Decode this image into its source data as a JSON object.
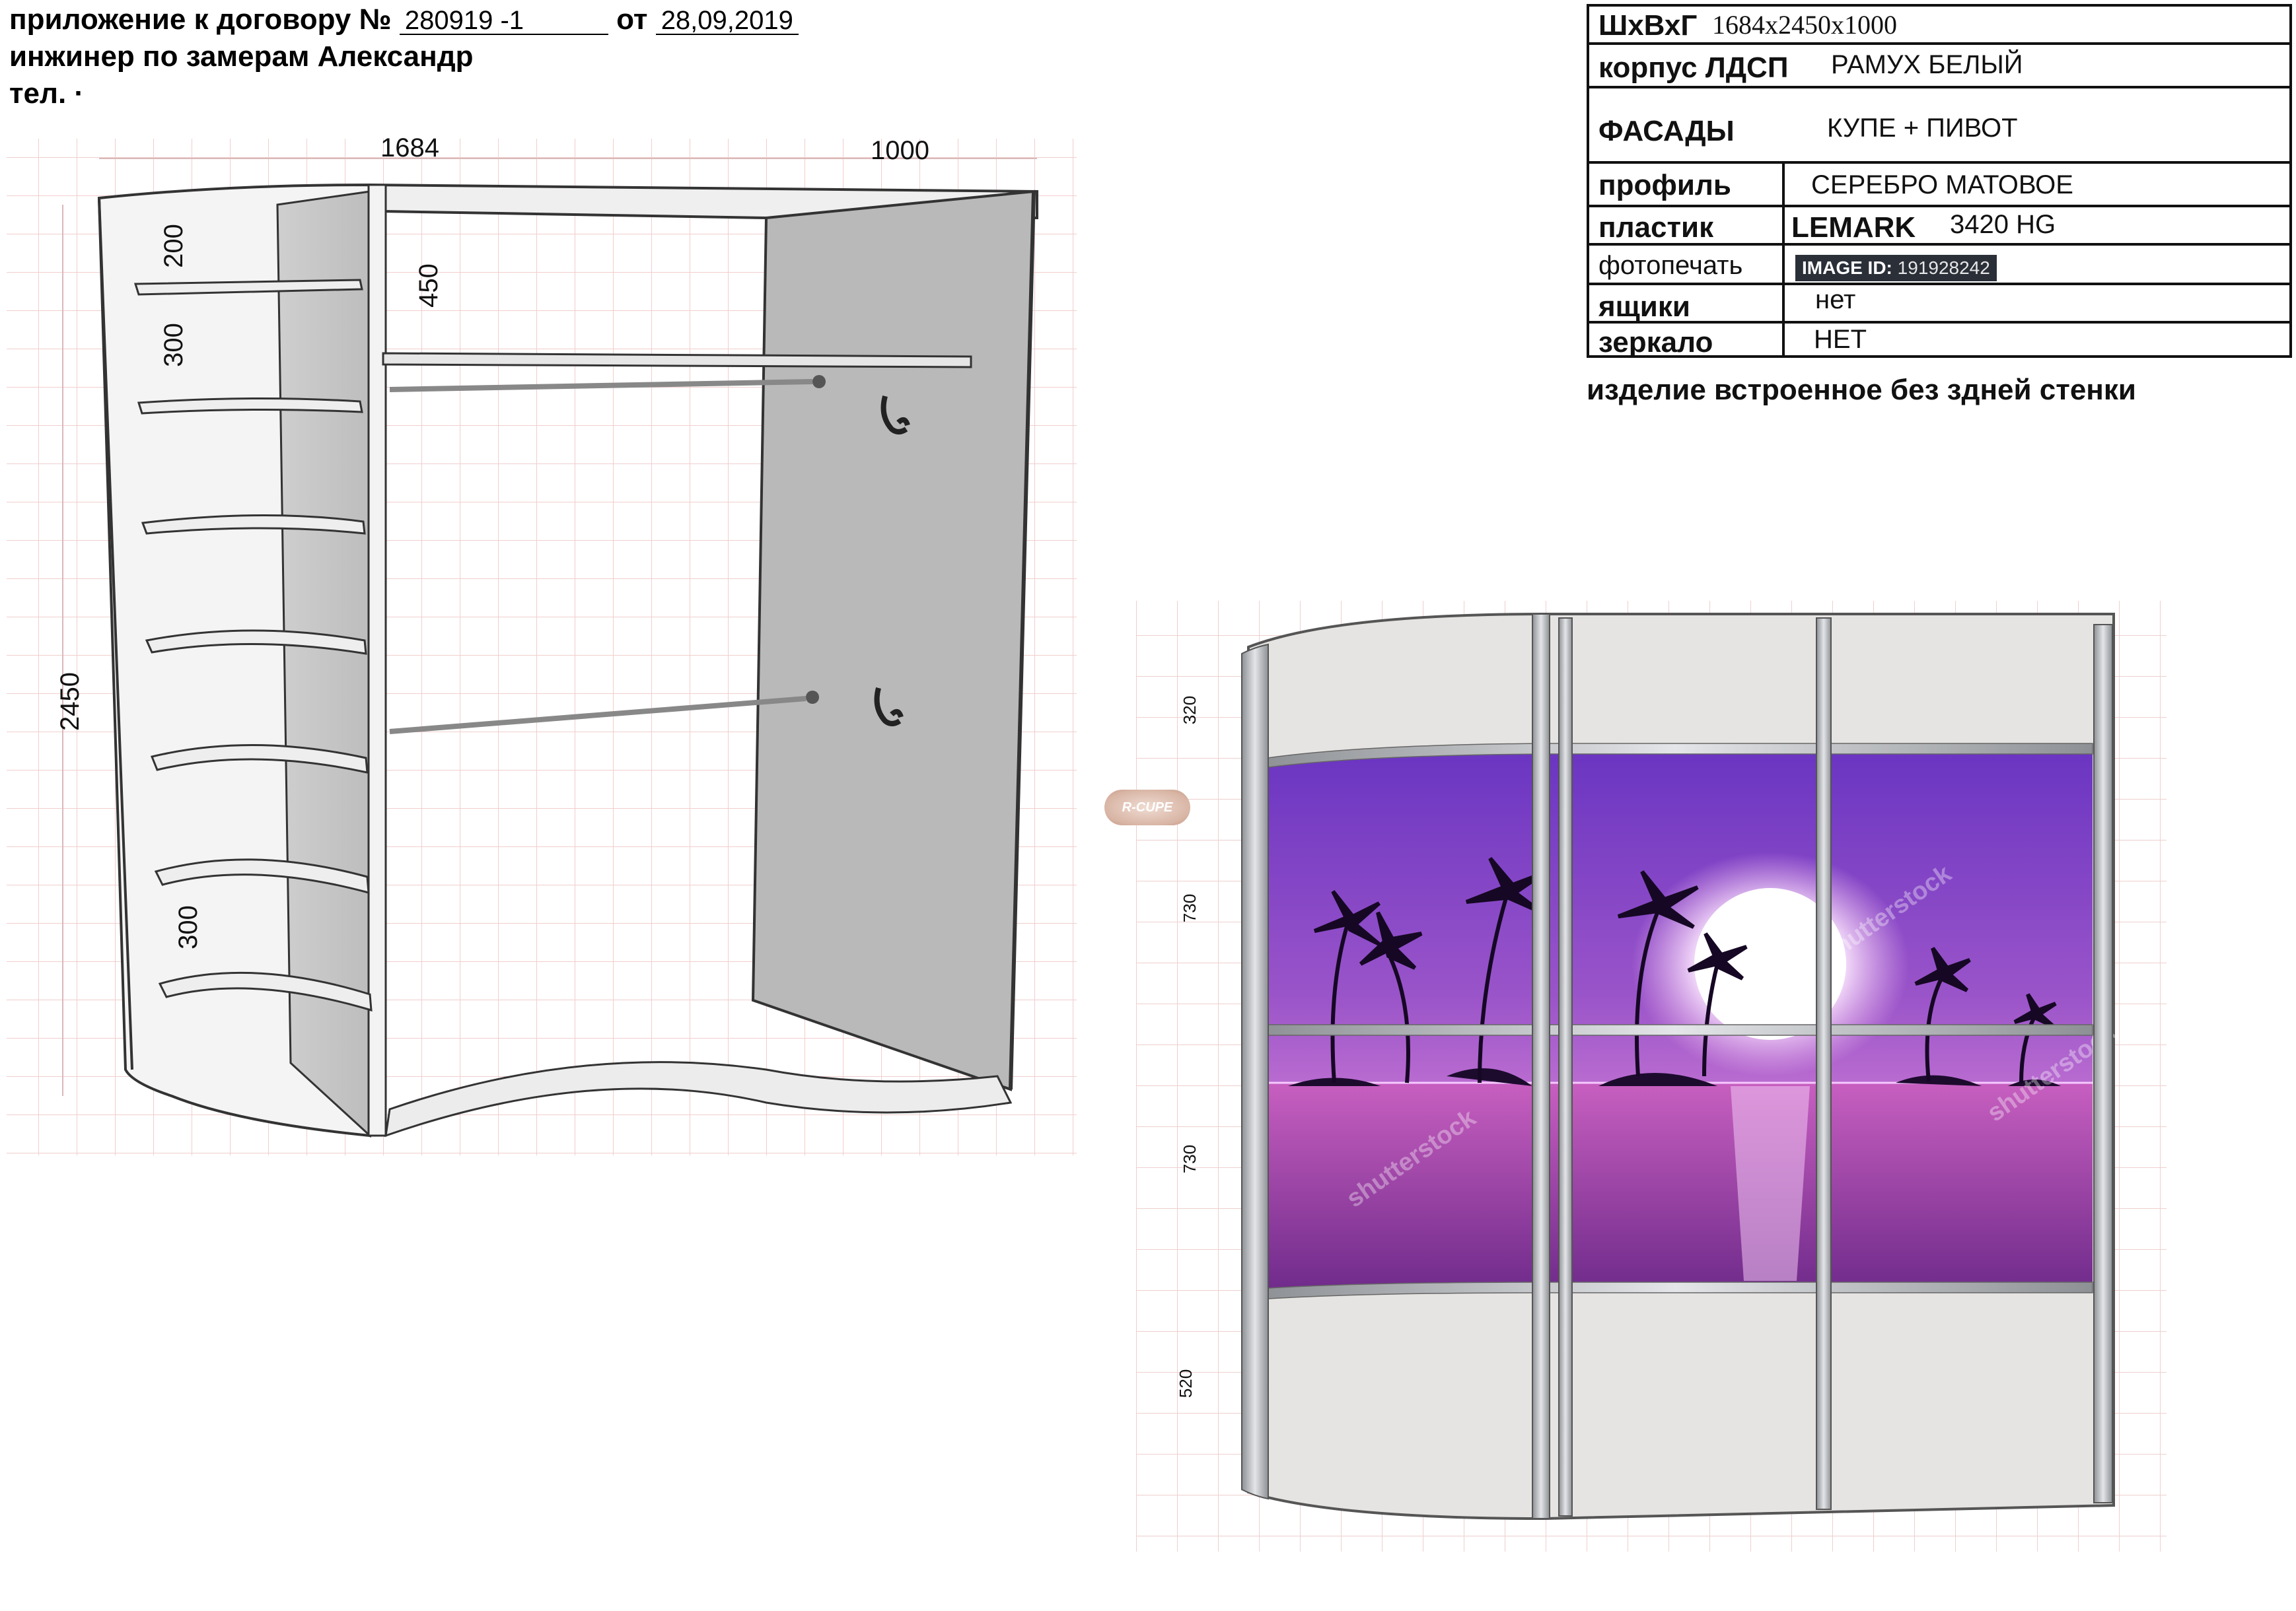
{
  "header": {
    "contract_label": "приложение к договору №",
    "contract_number": "280919 -1",
    "date_label": "от",
    "date_value": "28,09,2019",
    "engineer_line": "инжинер по замерам Александр",
    "phone_label": "тел. ·"
  },
  "spec": {
    "rows": [
      {
        "label": "ШхВхГ",
        "value": "1684х2450х1000"
      },
      {
        "label": "корпус ЛДСП",
        "value": "РАМУХ БЕЛЫЙ"
      },
      {
        "label": "ФАСАДЫ",
        "value": "КУПЕ + ПИВОТ"
      },
      {
        "label": "профиль",
        "value": "СЕРЕБРО МАТОВОЕ"
      },
      {
        "label": "пластик",
        "value_brand": "LEMARK",
        "value": "3420 HG"
      },
      {
        "label": "фотопечать",
        "image_id_label": "IMAGE ID:",
        "image_id_value": "191928242"
      },
      {
        "label": "ящики",
        "value": "нет"
      },
      {
        "label": "зеркало",
        "value": "НЕТ"
      }
    ],
    "note": "изделие встроенное без здней стенки"
  },
  "drawing_left": {
    "width_dim": "1684",
    "depth_dim": "1000",
    "height_dim": "2450",
    "shelf_gap_top": "200",
    "shelf_gap_second": "300",
    "shelf_gap_bottom": "300",
    "rail_gap": "450"
  },
  "drawing_right": {
    "section_top": "320",
    "section_mid_upper": "730",
    "section_mid_lower": "730",
    "section_bottom": "520",
    "badge": "R-CUPE",
    "watermark": "shutterstock"
  },
  "colors": {
    "photo_sky": "#7b3fc7",
    "photo_sea": "#b13fa6",
    "panel": "#e8e6e4",
    "profile": "#b9bcc0"
  }
}
